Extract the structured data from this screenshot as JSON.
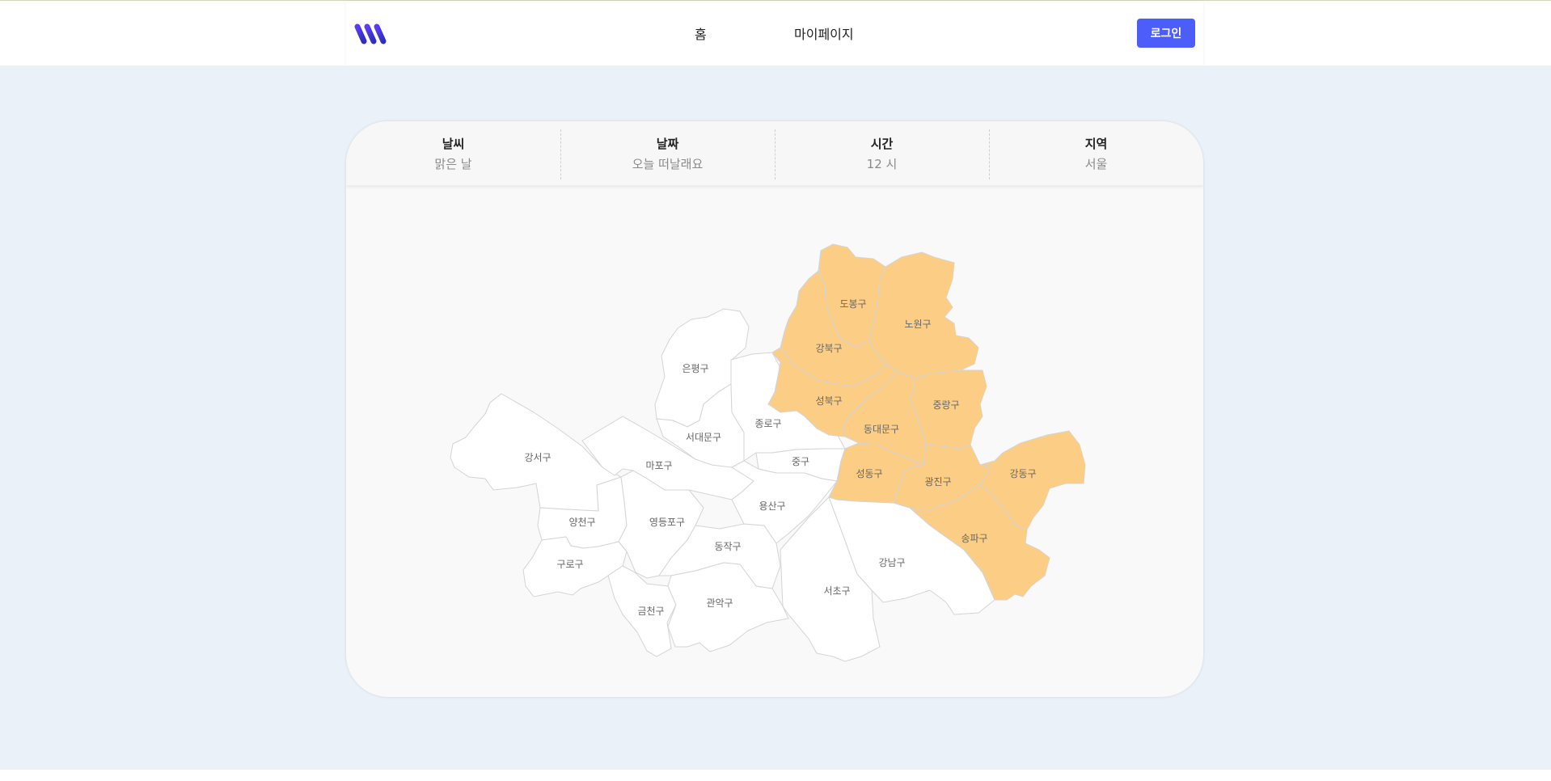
{
  "header": {
    "nav": {
      "home": "홈",
      "mypage": "마이페이지"
    },
    "login_label": "로그인"
  },
  "info": {
    "weather": {
      "label": "날씨",
      "value": "맑은 날"
    },
    "date": {
      "label": "날짜",
      "value": "오늘 떠날래요"
    },
    "time": {
      "label": "시간",
      "value": "12 시"
    },
    "region": {
      "label": "지역",
      "value": "서울"
    }
  },
  "colors": {
    "accent": "#4d5dfa",
    "highlight": "#fcce85",
    "district": "#ffffff",
    "background": "#eaf1f8"
  },
  "map": {
    "districts": [
      {
        "name": "도봉구",
        "highlighted": true
      },
      {
        "name": "노원구",
        "highlighted": true
      },
      {
        "name": "강북구",
        "highlighted": true
      },
      {
        "name": "성북구",
        "highlighted": true
      },
      {
        "name": "중랑구",
        "highlighted": true
      },
      {
        "name": "동대문구",
        "highlighted": true
      },
      {
        "name": "성동구",
        "highlighted": true
      },
      {
        "name": "광진구",
        "highlighted": true
      },
      {
        "name": "강동구",
        "highlighted": true
      },
      {
        "name": "송파구",
        "highlighted": true
      },
      {
        "name": "은평구",
        "highlighted": false
      },
      {
        "name": "종로구",
        "highlighted": false
      },
      {
        "name": "서대문구",
        "highlighted": false
      },
      {
        "name": "강서구",
        "highlighted": false
      },
      {
        "name": "마포구",
        "highlighted": false
      },
      {
        "name": "중구",
        "highlighted": false
      },
      {
        "name": "용산구",
        "highlighted": false
      },
      {
        "name": "양천구",
        "highlighted": false
      },
      {
        "name": "영등포구",
        "highlighted": false
      },
      {
        "name": "구로구",
        "highlighted": false
      },
      {
        "name": "동작구",
        "highlighted": false
      },
      {
        "name": "강남구",
        "highlighted": false
      },
      {
        "name": "서초구",
        "highlighted": false
      },
      {
        "name": "관악구",
        "highlighted": false
      },
      {
        "name": "금천구",
        "highlighted": false
      }
    ]
  }
}
